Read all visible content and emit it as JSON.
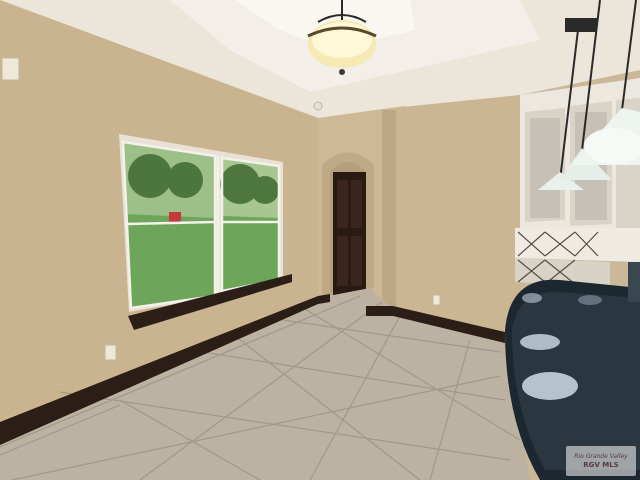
{
  "scene": {
    "subject": "empty dining nook with tile floor, window, arched doorway and kitchen bar"
  },
  "colors": {
    "wall": "#c8b490",
    "wall_light": "#d4c3a2",
    "ceiling": "#ece6db",
    "baseboard": "#2b1e17",
    "tile": "#bdb4a4",
    "grout": "#a39a8a",
    "door": "#2a1a14",
    "counter": "#1f2a33",
    "cabinet": "#ece8e0",
    "grass": "#5fae4e"
  },
  "watermark": {
    "line1": "Rio Grande Valley",
    "line2": "RGV MLS"
  }
}
